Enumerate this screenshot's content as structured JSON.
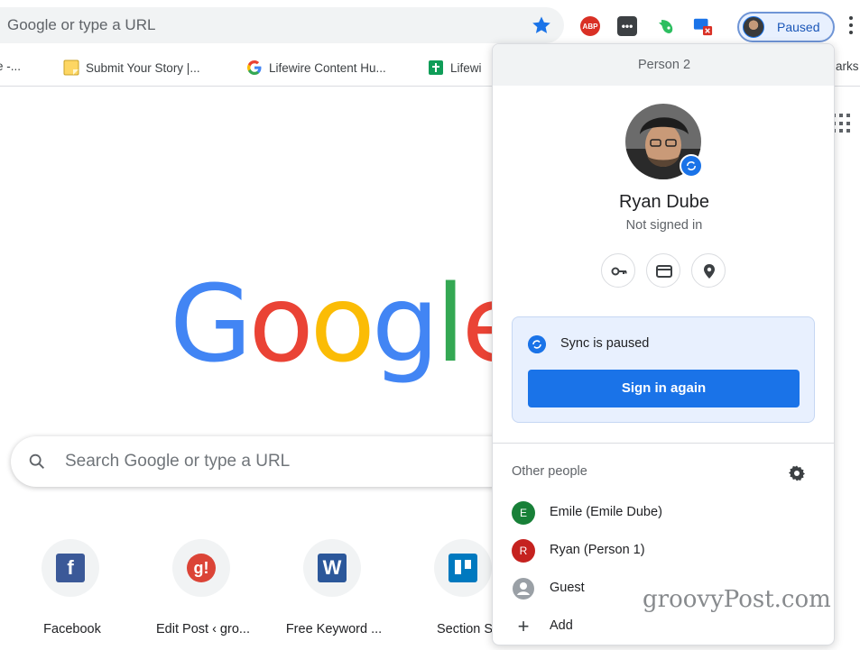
{
  "omnibox": {
    "text": "Google or type a URL"
  },
  "toolbar": {
    "extensions": [
      {
        "icon": "adblock-plus-icon",
        "label": "ABP"
      },
      {
        "icon": "dots-extension-icon",
        "label": "•••"
      },
      {
        "icon": "evernote-icon"
      },
      {
        "icon": "cast-tab-icon"
      }
    ],
    "profile_chip_label": "Paused",
    "accent_color": "#1a73e8"
  },
  "bookmarks": [
    {
      "label": "e -...",
      "icon": "page-icon"
    },
    {
      "label": "Submit Your Story |...",
      "icon": "note-icon"
    },
    {
      "label": "Lifewire Content Hu...",
      "icon": "google-icon"
    },
    {
      "label": "Lifewi",
      "icon": "google-sheets-icon"
    },
    {
      "label": "arks",
      "icon": ""
    }
  ],
  "ntp": {
    "logo": [
      "G",
      "o",
      "o",
      "g",
      "l",
      "e"
    ],
    "search_placeholder": "Search Google or type a URL",
    "shortcuts": [
      {
        "label": "Facebook",
        "icon": "facebook-icon",
        "glyph": "f",
        "color": "#3b5998"
      },
      {
        "label": "Edit Post ‹ gro...",
        "icon": "groovypost-icon",
        "glyph": "g!",
        "color": "#db4437"
      },
      {
        "label": "Free Keyword ...",
        "icon": "word-icon",
        "glyph": "W",
        "color": "#2b579a"
      },
      {
        "label": "Section S",
        "icon": "trello-icon",
        "glyph": "",
        "color": "#0079bf"
      }
    ]
  },
  "profile_menu": {
    "header": "Person 2",
    "name": "Ryan Dube",
    "status": "Not signed in",
    "action_icons": [
      "key-icon",
      "credit-card-icon",
      "location-pin-icon"
    ],
    "sync": {
      "text": "Sync is paused",
      "button_label": "Sign in again"
    },
    "other_people_title": "Other people",
    "people": [
      {
        "label": "Emile (Emile Dube)",
        "initial": "E",
        "color": "#188038"
      },
      {
        "label": "Ryan (Person 1)",
        "initial": "R",
        "color": "#c5221f"
      },
      {
        "label": "Guest",
        "initial": "",
        "color": "#9aa0a6"
      },
      {
        "label": "Add",
        "initial": "+",
        "color": ""
      }
    ]
  },
  "watermark": "groovyPost.com"
}
